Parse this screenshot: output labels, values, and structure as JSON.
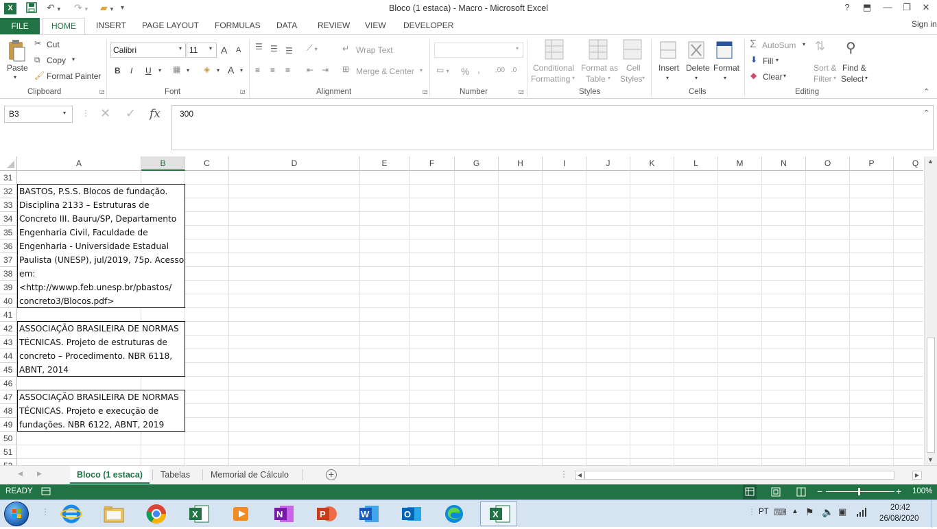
{
  "titlebar": {
    "title": "Bloco (1 estaca) - Macro - Microsoft Excel",
    "help": "?",
    "sign_in": "Sign in"
  },
  "ribbon_tabs": [
    "FILE",
    "HOME",
    "INSERT",
    "PAGE LAYOUT",
    "FORMULAS",
    "DATA",
    "REVIEW",
    "VIEW",
    "DEVELOPER"
  ],
  "clipboard": {
    "paste": "Paste",
    "cut": "Cut",
    "copy": "Copy",
    "format_painter": "Format Painter",
    "label": "Clipboard"
  },
  "font": {
    "name": "Calibri",
    "size": "11",
    "bold": "B",
    "italic": "I",
    "underline": "U",
    "label": "Font",
    "grow": "A",
    "shrink": "A",
    "color": "A"
  },
  "alignment": {
    "wrap_text": "Wrap Text",
    "merge_center": "Merge & Center",
    "label": "Alignment"
  },
  "number": {
    "format": "",
    "percent": "%",
    "comma": ",",
    "increase_dec": ".00",
    "decrease_dec": ".0",
    "label": "Number"
  },
  "styles": {
    "conditional_l1": "Conditional",
    "conditional_l2": "Formatting",
    "format_table_l1": "Format as",
    "format_table_l2": "Table",
    "cell_styles_l1": "Cell",
    "cell_styles_l2": "Styles",
    "label": "Styles"
  },
  "cells": {
    "insert": "Insert",
    "delete": "Delete",
    "format": "Format",
    "label": "Cells"
  },
  "editing": {
    "autosum": "AutoSum",
    "fill": "Fill",
    "clear": "Clear",
    "sort_l1": "Sort &",
    "sort_l2": "Filter",
    "find_l1": "Find &",
    "find_l2": "Select",
    "label": "Editing"
  },
  "formula_bar": {
    "name_box": "B3",
    "fx": "fx",
    "value": "300"
  },
  "columns": [
    "A",
    "B",
    "C",
    "D",
    "E",
    "F",
    "G",
    "H",
    "I",
    "J",
    "K",
    "L",
    "M",
    "N",
    "O",
    "P",
    "Q"
  ],
  "rows": [
    "31",
    "32",
    "33",
    "34",
    "35",
    "36",
    "37",
    "38",
    "39",
    "40",
    "41",
    "42",
    "43",
    "44",
    "45",
    "46",
    "47",
    "48",
    "49",
    "50",
    "51",
    "52"
  ],
  "cells_text": {
    "r32": "BASTOS, P.S.S. Blocos de fundação.",
    "r33": "Disciplina 2133 – Estruturas de",
    "r34": "Concreto III. Bauru/SP, Departamento",
    "r35": "Engenharia Civil, Faculdade de",
    "r36": "Engenharia - Universidade Estadual",
    "r37": "Paulista (UNESP), jul/2019, 75p. Acesso",
    "r38": "em:",
    "r39": "<http://wwwp.feb.unesp.br/pbastos/",
    "r40": "concreto3/Blocos.pdf>",
    "r42": "ASSOCIAÇÃO BRASILEIRA DE NORMAS",
    "r43": "TÉCNICAS. Projeto de estruturas de",
    "r44": "concreto – Procedimento. NBR 6118,",
    "r45": "ABNT, 2014",
    "r47": "ASSOCIAÇÃO BRASILEIRA DE NORMAS",
    "r48": "TÉCNICAS. Projeto e execução de",
    "r49": "fundações. NBR 6122, ABNT, 2019"
  },
  "sheets": [
    "Bloco (1 estaca)",
    "Tabelas",
    "Memorial de Cálculo"
  ],
  "status": {
    "ready": "READY",
    "zoom": "100%"
  },
  "taskbar": {
    "lang": "PT",
    "time": "20:42",
    "date": "26/08/2020"
  },
  "colors": {
    "excel_green": "#217346",
    "taskbar": "#d6e4f2"
  }
}
